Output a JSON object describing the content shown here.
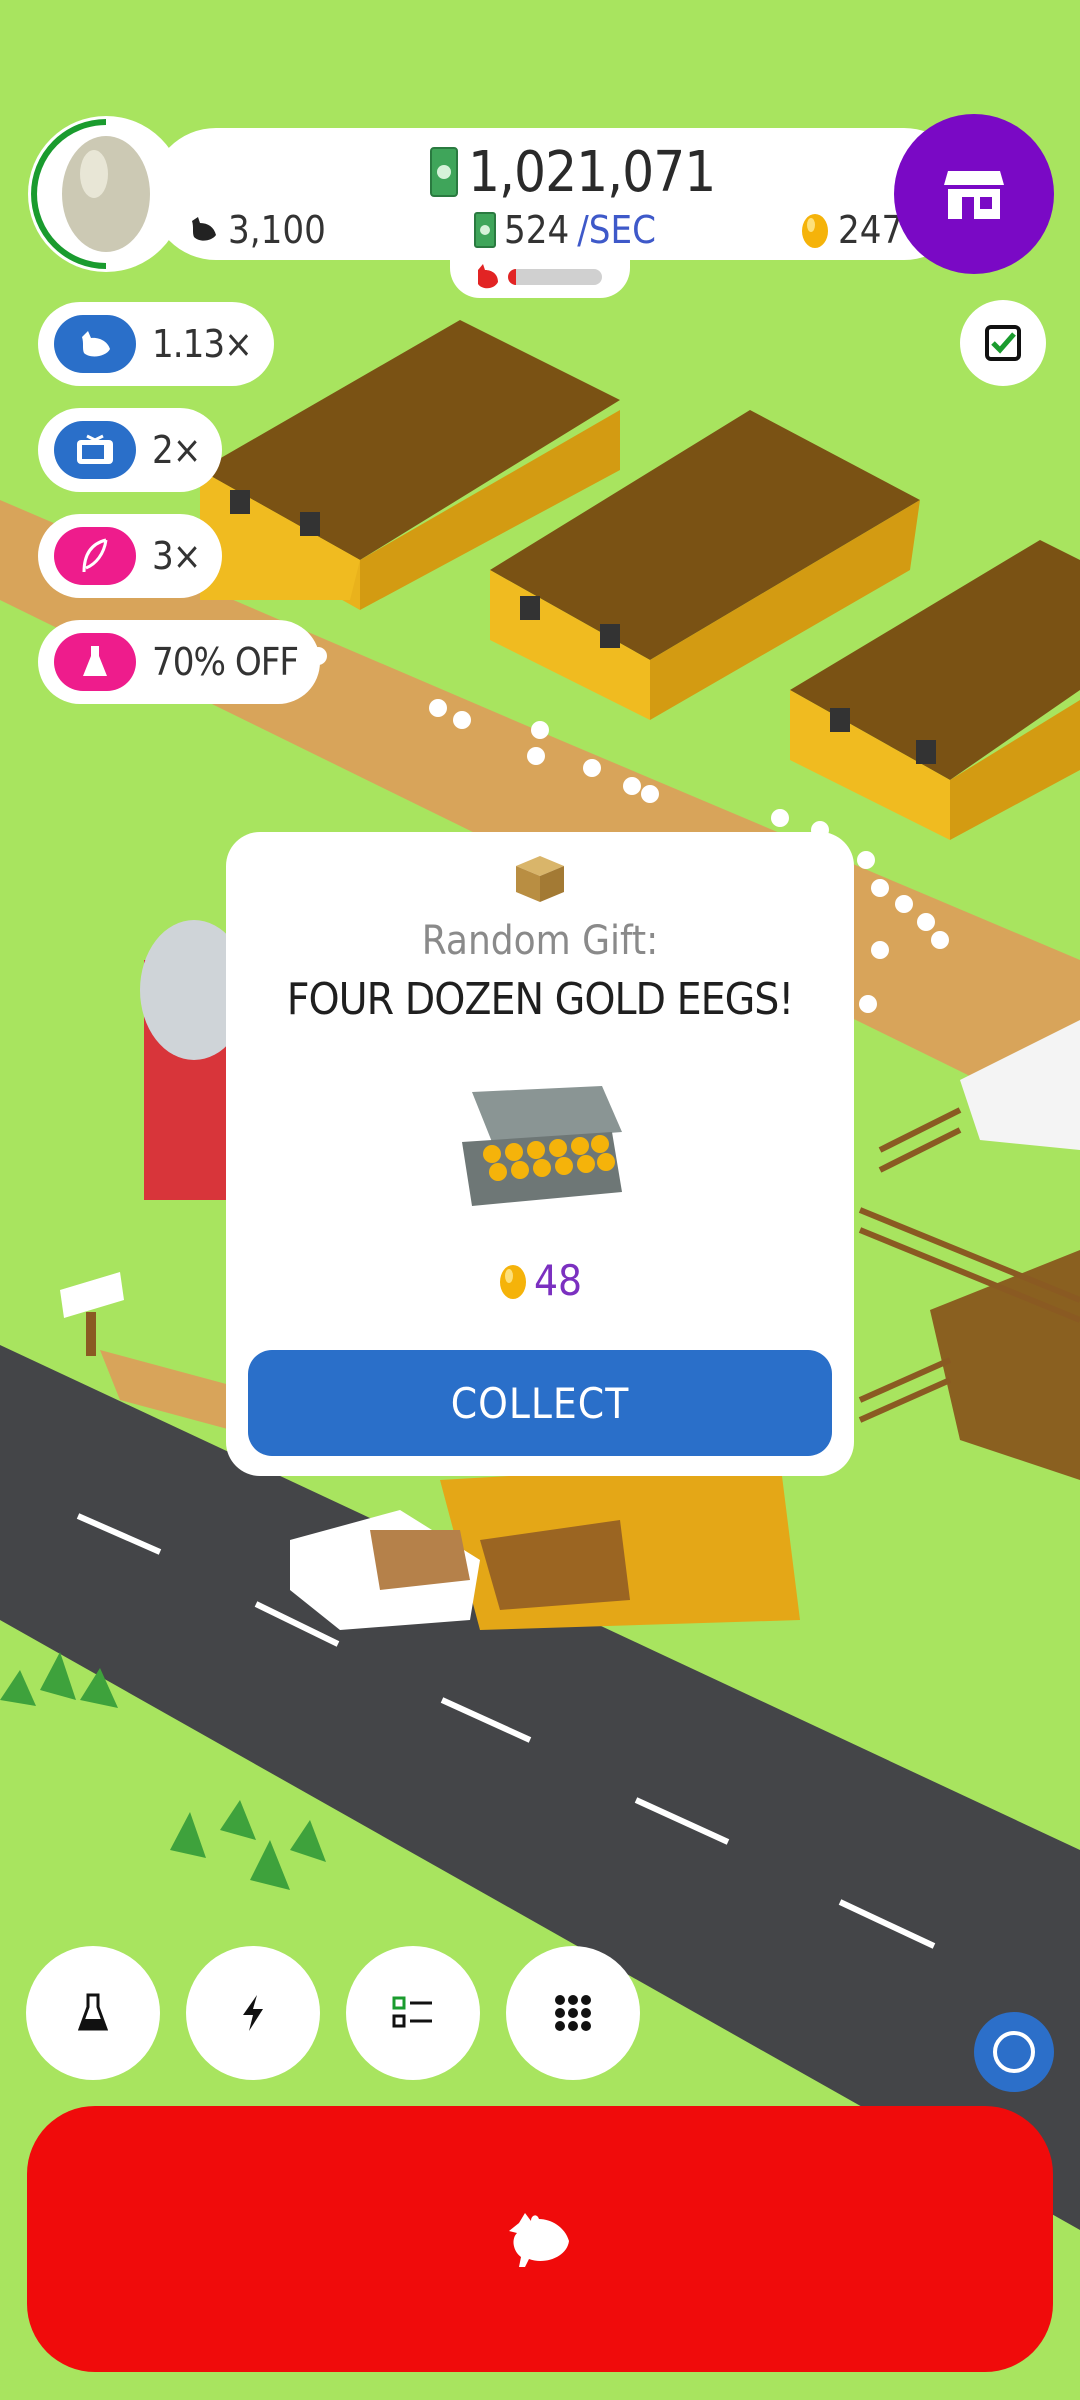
{
  "hud": {
    "money": "1,021,071",
    "income_rate": "524",
    "income_unit": "/SEC",
    "chickens": "3,100",
    "golden_eggs": "247",
    "hatchery_progress": 0.08
  },
  "boosts": [
    {
      "label": "1.13×",
      "icon": "chicken-icon",
      "color": "#2a6fc9"
    },
    {
      "label": "2×",
      "icon": "tv-icon",
      "color": "#2a6fc9"
    },
    {
      "label": "3×",
      "icon": "feather-icon",
      "color": "#ee1c8c"
    },
    {
      "label": "70% OFF",
      "icon": "flask-icon",
      "color": "#ee1c8c"
    }
  ],
  "gift": {
    "title": "Random Gift:",
    "reward": "FOUR DOZEN GOLD EEGS!",
    "amount": "48",
    "collect_label": "COLLECT"
  },
  "bottom_buttons": [
    {
      "name": "research-button",
      "icon": "flask-icon"
    },
    {
      "name": "boosts-button",
      "icon": "lightning-icon"
    },
    {
      "name": "missions-button",
      "icon": "checklist-icon"
    },
    {
      "name": "menu-button",
      "icon": "grid-icon"
    }
  ],
  "colors": {
    "grass": "#a8e45f",
    "shop": "#7a09c5",
    "hatch": "#f00b0b",
    "accent_blue": "#2a6fc9",
    "gold": "#f5b30a"
  }
}
